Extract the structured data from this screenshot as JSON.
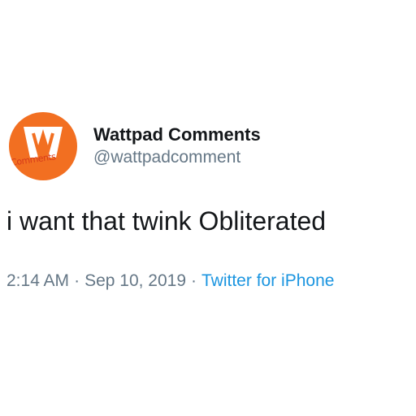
{
  "tweet": {
    "author": {
      "display_name": "Wattpad Comments",
      "handle": "@wattpadcomment",
      "avatar_label": "Comments",
      "avatar_icon": "wattpad-w-logo-icon",
      "avatar_color": "#f26f21"
    },
    "text": "i want that twink Obliterated",
    "time": "2:14 AM",
    "separator": "·",
    "date": "Sep 10, 2019",
    "source": "Twitter for iPhone",
    "source_color": "#1b95e0"
  }
}
